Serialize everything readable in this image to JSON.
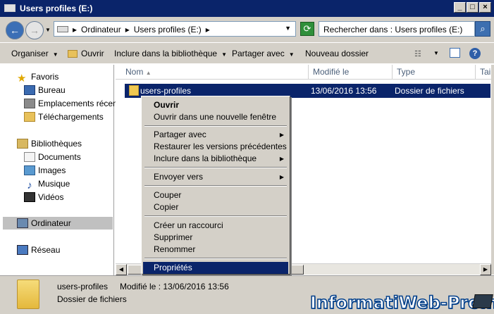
{
  "window": {
    "title": "Users profiles (E:)"
  },
  "address": {
    "crumbs": [
      "Ordinateur",
      "Users profiles (E:)"
    ],
    "search_placeholder": "Rechercher dans : Users profiles (E:)"
  },
  "toolbar": {
    "organize": "Organiser",
    "open": "Ouvrir",
    "include": "Inclure dans la bibliothèque",
    "share": "Partager avec",
    "new_folder": "Nouveau dossier"
  },
  "nav": {
    "favorites": "Favoris",
    "desktop": "Bureau",
    "recent": "Emplacements récents",
    "downloads": "Téléchargements",
    "libraries": "Bibliothèques",
    "documents": "Documents",
    "images": "Images",
    "music": "Musique",
    "videos": "Vidéos",
    "computer": "Ordinateur",
    "network": "Réseau"
  },
  "columns": {
    "name": "Nom",
    "modified": "Modifié le",
    "type": "Type",
    "size": "Tail"
  },
  "files": [
    {
      "name": "users-profiles",
      "modified": "13/06/2016 13:56",
      "type": "Dossier de fichiers"
    }
  ],
  "context_menu": {
    "open": "Ouvrir",
    "open_new_window": "Ouvrir dans une nouvelle fenêtre",
    "share_with": "Partager avec",
    "restore": "Restaurer les versions précédentes",
    "include": "Inclure dans la bibliothèque",
    "send_to": "Envoyer vers",
    "cut": "Couper",
    "copy": "Copier",
    "shortcut": "Créer un raccourci",
    "delete": "Supprimer",
    "rename": "Renommer",
    "properties": "Propriétés"
  },
  "details": {
    "name": "users-profiles",
    "modified": "Modifié le : 13/06/2016 13:56",
    "type": "Dossier de fichiers"
  },
  "watermark": "InformatiWeb-Pro.net"
}
